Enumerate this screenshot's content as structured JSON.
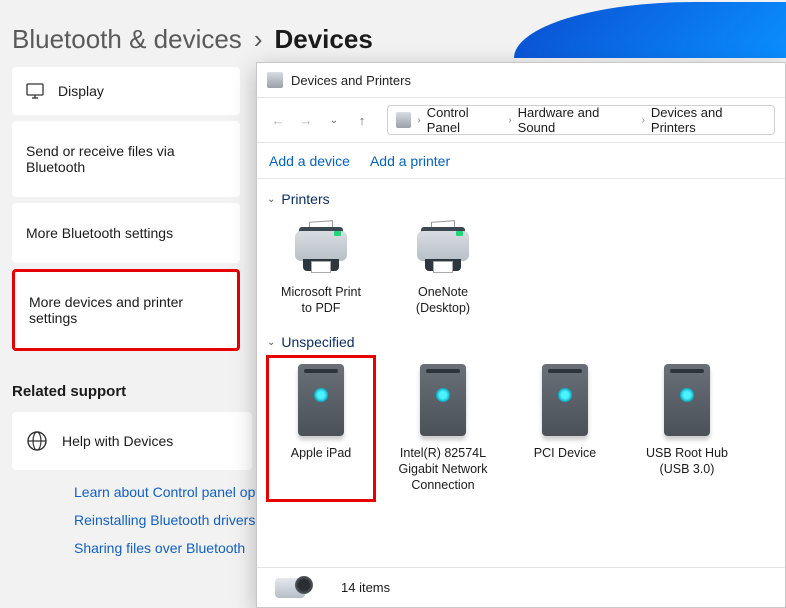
{
  "settings": {
    "breadcrumb_parent": "Bluetooth & devices",
    "breadcrumb_sep": "›",
    "breadcrumb_current": "Devices",
    "items": {
      "display": "Display",
      "send_receive": "Send or receive files via Bluetooth",
      "more_bt": "More Bluetooth settings",
      "more_dp": "More devices and printer settings"
    },
    "related_title": "Related support",
    "help_with_devices": "Help with Devices",
    "links": {
      "cp": "Learn about Control panel options",
      "reinstall": "Reinstalling Bluetooth drivers",
      "share": "Sharing files over Bluetooth"
    }
  },
  "dp": {
    "title": "Devices and Printers",
    "address": [
      "Control Panel",
      "Hardware and Sound",
      "Devices and Printers"
    ],
    "toolbar": {
      "add_device": "Add a device",
      "add_printer": "Add a printer"
    },
    "cat_printers": "Printers",
    "printers": [
      {
        "name": "Microsoft Print to PDF"
      },
      {
        "name": "OneNote (Desktop)"
      }
    ],
    "cat_unspecified": "Unspecified",
    "devices": [
      {
        "name": "Apple iPad",
        "selected": true
      },
      {
        "name": "Intel(R) 82574L Gigabit Network Connection"
      },
      {
        "name": "PCI Device"
      },
      {
        "name": "USB Root Hub (USB 3.0)"
      }
    ],
    "status": "14 items"
  }
}
